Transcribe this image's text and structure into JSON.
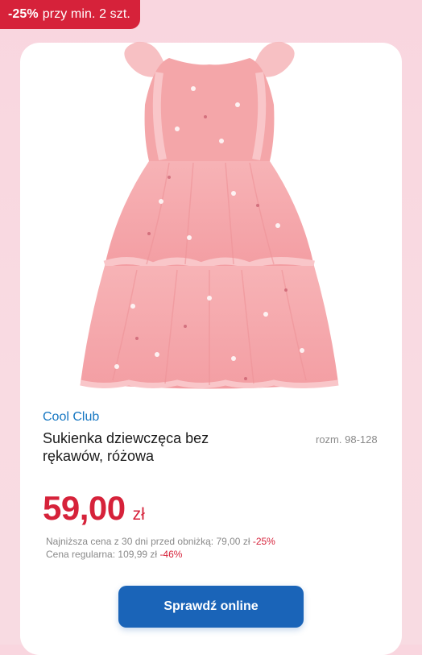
{
  "promo": {
    "percent": "-25%",
    "text": "przy min. 2 szt."
  },
  "product": {
    "brand": "Cool Club",
    "name": "Sukienka dziewczęca bez rękawów, różowa",
    "sizes": "rozm. 98-128",
    "image_icon": "pink-tulle-dress-illustration"
  },
  "price": {
    "amount": "59,00",
    "currency": "zł",
    "lowest30_label": "Najniższa cena z 30 dni przed obniżką: 79,00 zł",
    "lowest30_discount": "-25%",
    "regular_label": "Cena regularna: 109,99 zł",
    "regular_discount": "-46%"
  },
  "cta": {
    "label": "Sprawdź online"
  },
  "colors": {
    "accent": "#d6223a",
    "brand_link": "#1677c2",
    "button": "#1a64b8",
    "dress": "#f5a3a8",
    "background": "#f9d6df"
  }
}
